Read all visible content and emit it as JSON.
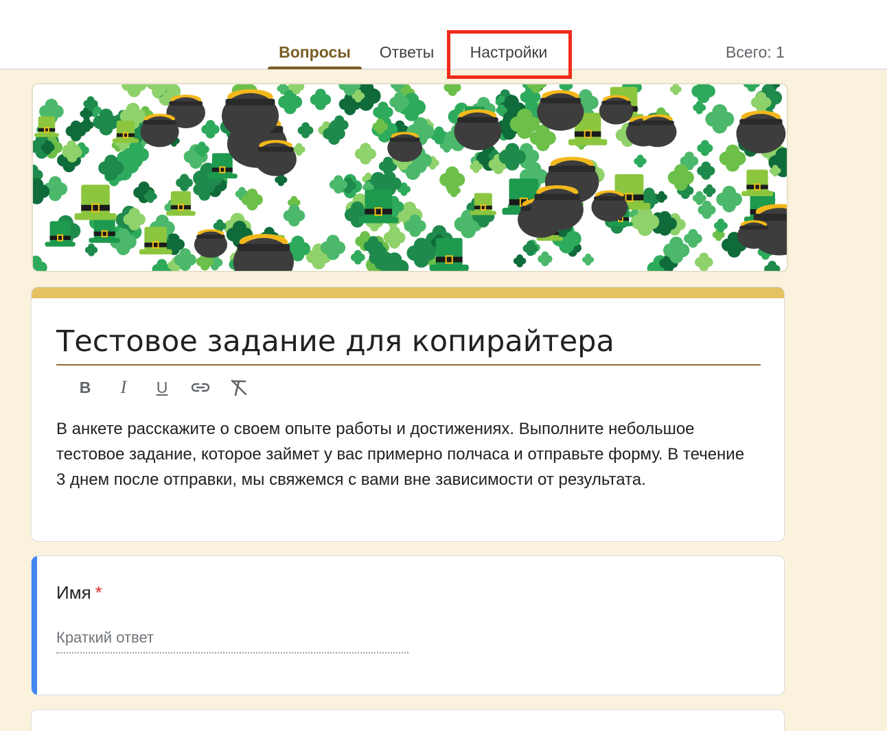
{
  "tabs": [
    {
      "label": "Вопросы",
      "active": true
    },
    {
      "label": "Ответы",
      "active": false
    },
    {
      "label": "Настройки",
      "active": false
    }
  ],
  "total_label": "Всего: 1",
  "colors": {
    "accent": "#7a5d25",
    "theme_strip": "#e4c264",
    "background": "#faf2dc",
    "highlight": "#f02a1a",
    "question_focus": "#4285f4"
  },
  "header_image": {
    "icon": "shamrock-pattern-image"
  },
  "form": {
    "title": "Тестовое задание для копирайтера",
    "toolbar": {
      "bold": "B",
      "italic": "I",
      "underline": "U",
      "link_icon": "link-icon",
      "clear_format_icon": "clear-format-icon"
    },
    "description": "В анкете расскажите о своем опыте работы и достижениях. Выполните небольшое тестовое задание, которое займет у вас примерно полчаса и отправьте форму. В течение 3 днем после отправки, мы свяжемся с вами вне зависимости от результата."
  },
  "question": {
    "label": "Имя",
    "required_mark": "*",
    "answer_placeholder": "Краткий ответ"
  }
}
